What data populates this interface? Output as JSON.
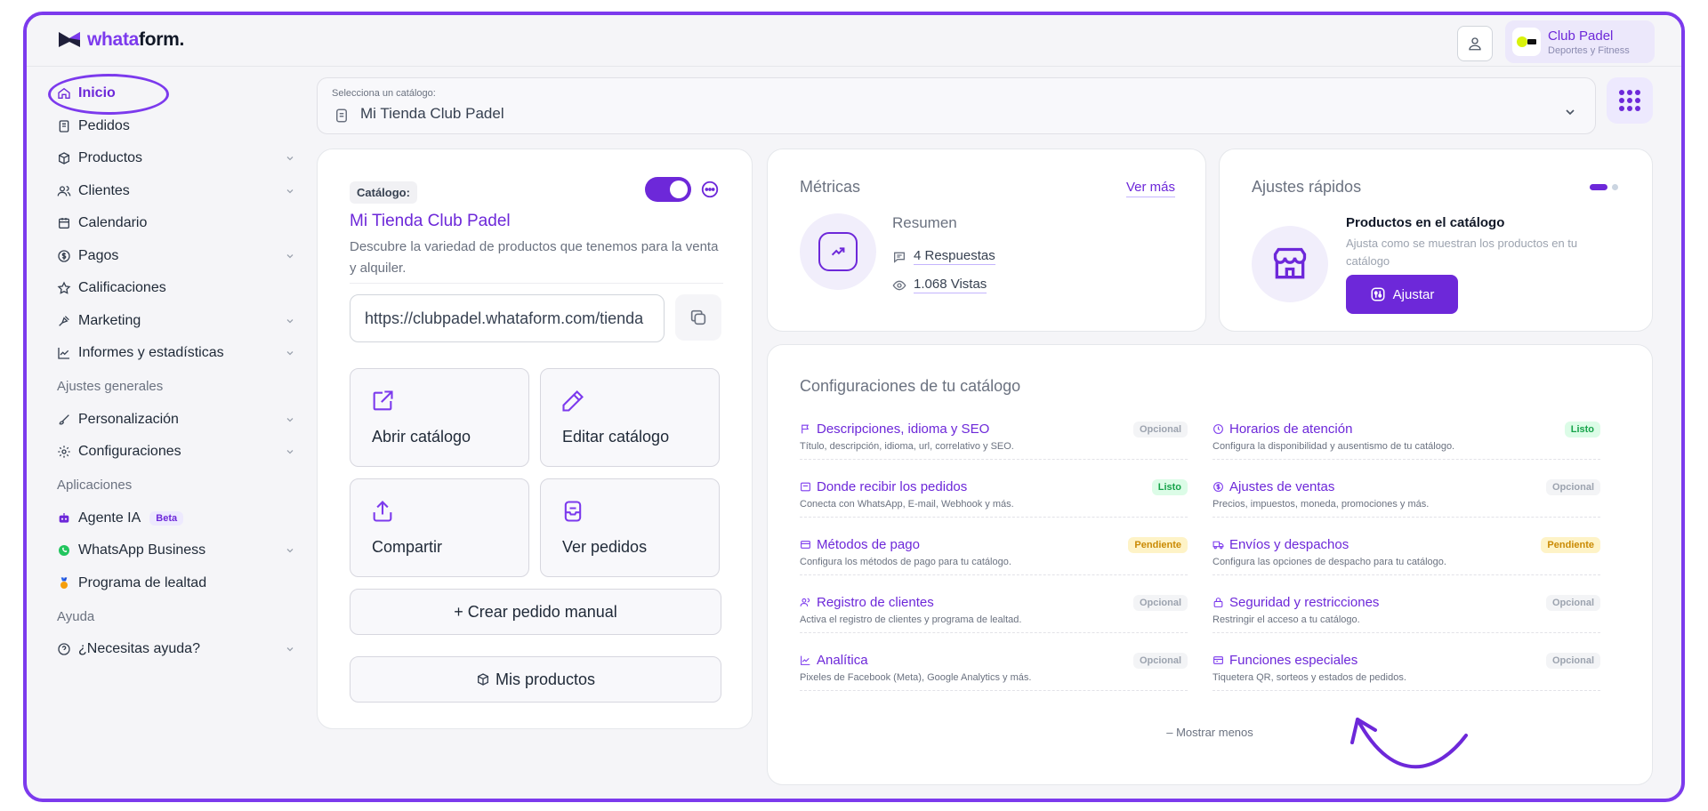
{
  "brand": {
    "name_part1": "whata",
    "name_part2": "form.",
    "accent": "#7c3aed"
  },
  "account": {
    "name": "Club Padel",
    "category": "Deportes y Fitness"
  },
  "sidebar": {
    "items": [
      {
        "label": "Inicio"
      },
      {
        "label": "Pedidos"
      },
      {
        "label": "Productos"
      },
      {
        "label": "Clientes"
      },
      {
        "label": "Calendario"
      },
      {
        "label": "Pagos"
      },
      {
        "label": "Calificaciones"
      },
      {
        "label": "Marketing"
      },
      {
        "label": "Informes y estadísticas"
      }
    ],
    "section_general": "Ajustes generales",
    "general_items": [
      {
        "label": "Personalización"
      },
      {
        "label": "Configuraciones"
      }
    ],
    "section_apps": "Aplicaciones",
    "app_items": [
      {
        "label": "Agente IA",
        "badge": "Beta"
      },
      {
        "label": "WhatsApp Business"
      },
      {
        "label": "Programa de lealtad"
      }
    ],
    "section_help": "Ayuda",
    "help_items": [
      {
        "label": "¿Necesitas ayuda?"
      }
    ]
  },
  "catalog_select": {
    "label": "Selecciona un catálogo:",
    "value": "Mi Tienda Club Padel"
  },
  "catalog_card": {
    "chip": "Catálogo:",
    "title": "Mi Tienda Club Padel",
    "description": "Descubre la variedad de productos que tenemos para la venta y alquiler.",
    "url": "https://clubpadel.whataform.com/tienda",
    "tiles": {
      "open": "Abrir catálogo",
      "edit": "Editar catálogo",
      "share": "Compartir",
      "orders": "Ver pedidos"
    },
    "create_order": "+ Crear pedido manual",
    "my_products": "Mis productos"
  },
  "metrics": {
    "title": "Métricas",
    "see_more": "Ver más",
    "summary": "Resumen",
    "responses": "4 Respuestas",
    "views": "1.068 Vistas"
  },
  "quick": {
    "title": "Ajustes rápidos",
    "item_title": "Productos en el catálogo",
    "item_desc": "Ajusta como se muestran los productos en tu catálogo",
    "button": "Ajustar"
  },
  "config": {
    "title": "Configuraciones de tu catálogo",
    "items": [
      {
        "title": "Descripciones, idioma y SEO",
        "sub": "Título, descripción, idioma, url, correlativo y SEO.",
        "status": "Opcional"
      },
      {
        "title": "Horarios de atención",
        "sub": "Configura la disponibilidad y ausentismo de tu catálogo.",
        "status": "Listo"
      },
      {
        "title": "Donde recibir los pedidos",
        "sub": "Conecta con WhatsApp, E-mail, Webhook y más.",
        "status": "Listo"
      },
      {
        "title": "Ajustes de ventas",
        "sub": "Precios, impuestos, moneda, promociones y más.",
        "status": "Opcional"
      },
      {
        "title": "Métodos de pago",
        "sub": "Configura los métodos de pago para tu catálogo.",
        "status": "Pendiente"
      },
      {
        "title": "Envíos y despachos",
        "sub": "Configura las opciones de despacho para tu catálogo.",
        "status": "Pendiente"
      },
      {
        "title": "Registro de clientes",
        "sub": "Activa el registro de clientes y programa de lealtad.",
        "status": "Opcional"
      },
      {
        "title": "Seguridad y restricciones",
        "sub": "Restringir el acceso a tu catálogo.",
        "status": "Opcional"
      },
      {
        "title": "Analítica",
        "sub": "Pixeles de Facebook (Meta), Google Analytics y más.",
        "status": "Opcional"
      },
      {
        "title": "Funciones especiales",
        "sub": "Tiquetera QR, sorteos y estados de pedidos.",
        "status": "Opcional"
      }
    ],
    "show_less": "Mostrar menos"
  },
  "icons": [
    "home-icon",
    "orders-icon",
    "products-icon",
    "clients-icon",
    "calendar-icon",
    "payments-icon",
    "star-icon",
    "marketing-icon",
    "chart-icon",
    "brush-icon",
    "gear-icon",
    "robot-icon",
    "whatsapp-icon",
    "medal-icon",
    "help-icon",
    "user-icon",
    "apps-grid-icon",
    "copy-icon",
    "external-link-icon",
    "edit-icon",
    "share-icon",
    "trend-icon",
    "store-icon",
    "sliders-icon"
  ]
}
